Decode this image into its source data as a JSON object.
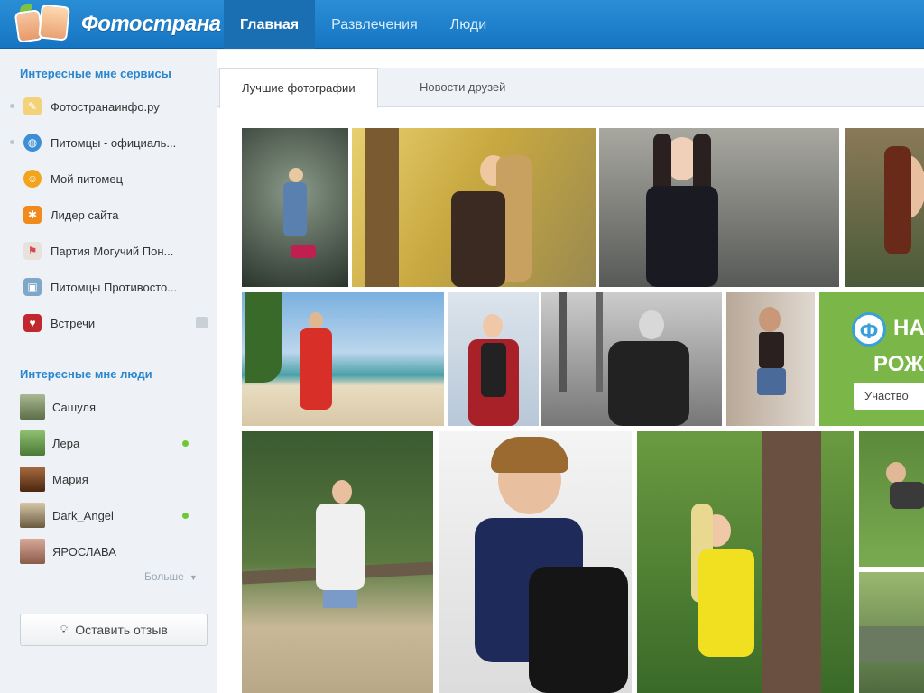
{
  "header": {
    "logo_text": "Фотострана",
    "nav": [
      {
        "label": "Главная",
        "active": true
      },
      {
        "label": "Развлечения",
        "active": false
      },
      {
        "label": "Люди",
        "active": false
      }
    ]
  },
  "sidebar": {
    "services_heading": "Интересные мне сервисы",
    "services": [
      {
        "label": "Фотостранаинфо.ру",
        "icon": "pencil-icon",
        "color": "#e9b84a"
      },
      {
        "label": "Питомцы - официаль...",
        "icon": "globe-icon",
        "color": "#3c8fd4"
      },
      {
        "label": "Мой питомец",
        "icon": "pet-icon",
        "color": "#f2a51c"
      },
      {
        "label": "Лидер сайта",
        "icon": "star-icon",
        "color": "#f08a1c"
      },
      {
        "label": "Партия Могучий Пон...",
        "icon": "flag-icon",
        "color": "#d84a4a"
      },
      {
        "label": "Питомцы Противосто...",
        "icon": "game-icon",
        "color": "#4a8cc8"
      },
      {
        "label": "Встречи",
        "icon": "meet-icon",
        "color": "#c0282e"
      }
    ],
    "people_heading": "Интересные мне люди",
    "people": [
      {
        "name": "Сашуля",
        "online": false,
        "color": "#8a9a70"
      },
      {
        "name": "Лера",
        "online": true,
        "color": "#6f9a55"
      },
      {
        "name": "Мария",
        "online": false,
        "color": "#7a4a2a"
      },
      {
        "name": "Dark_Angel",
        "online": true,
        "color": "#9a8a70"
      },
      {
        "name": "ЯРОСЛАВА",
        "online": false,
        "color": "#b07a6a"
      }
    ],
    "more_label": "Больше",
    "feedback_label": "Оставить отзыв"
  },
  "content": {
    "tabs": [
      {
        "label": "Лучшие фотографии",
        "active": true
      },
      {
        "label": "Новости друзей",
        "active": false
      }
    ],
    "ad": {
      "logo_letter": "Ф",
      "line1": "НА",
      "line2": "РОЖ",
      "button": "Участво"
    }
  },
  "colors": {
    "header_bg": "#1f82cc",
    "accent": "#2a86cf",
    "online": "#6ec832",
    "ad_bg": "#7ab648"
  }
}
